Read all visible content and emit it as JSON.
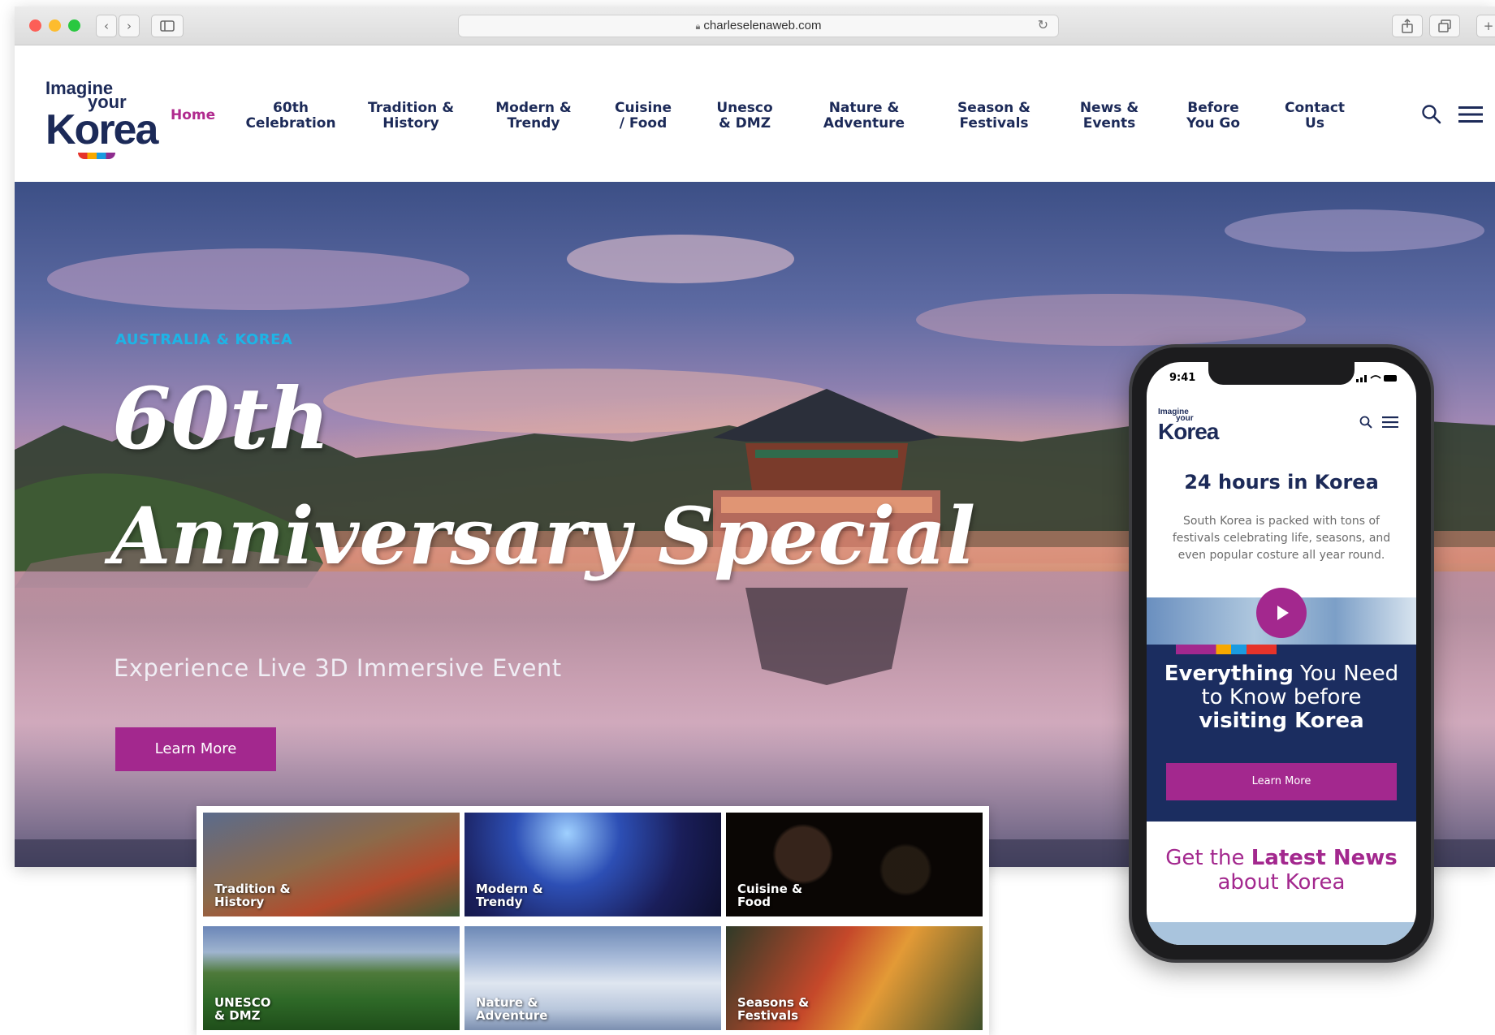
{
  "browser": {
    "url": "charleselenaweb.com",
    "back": "‹",
    "forward": "›"
  },
  "logo": {
    "line1": "Imagine",
    "line2": "your",
    "line3": "Korea"
  },
  "nav": {
    "home": "Home",
    "items": [
      "60th\nCelebration",
      "Tradition &\nHistory",
      "Modern &\nTrendy",
      "Cuisine\n/ Food",
      "Unesco\n& DMZ",
      "Nature &\nAdventure",
      "Season &\nFestivals",
      "News &\nEvents",
      "Before\nYou Go",
      "Contact\nUs"
    ]
  },
  "hero": {
    "kicker": "AUSTRALIA & KOREA",
    "title_line1": "60th",
    "title_line2": "Anniversary Special",
    "subtitle": "Experience Live 3D Immersive Event",
    "cta": "Learn More"
  },
  "tiles": [
    {
      "label": "Tradition &\nHistory"
    },
    {
      "label": "Modern &\nTrendy"
    },
    {
      "label": "Cuisine &\nFood"
    },
    {
      "label": "UNESCO\n& DMZ"
    },
    {
      "label": "Nature &\nAdventure"
    },
    {
      "label": "Seasons &\nFestivals"
    }
  ],
  "phone": {
    "time": "9:41",
    "logo": {
      "line1": "Imagine",
      "line2": "your",
      "line3": "Korea"
    },
    "title": "24 hours in Korea",
    "body": "South Korea is packed with tons of festivals celebrating life, seasons, and even popular costure all year round.",
    "navy_title_bold1": "Everything",
    "navy_title_rest1": " You Need",
    "navy_title_line2": "to Know before",
    "navy_title_bold3": "visiting Korea",
    "cta": "Learn More",
    "news_plain": "Get the ",
    "news_bold": "Latest News",
    "news_line2": "about Korea"
  },
  "colors": {
    "navy": "#1c2a58",
    "magenta": "#a3288e",
    "kicker_blue": "#1eb4e6"
  }
}
